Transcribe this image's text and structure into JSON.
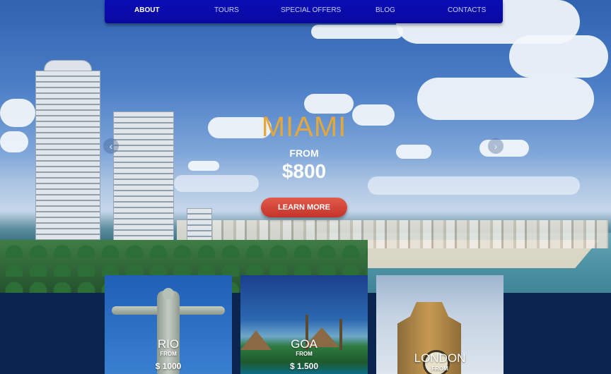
{
  "nav": {
    "items": [
      {
        "label": "ABOUT",
        "active": true
      },
      {
        "label": "TOURS",
        "active": false
      },
      {
        "label": "SPECIAL OFFERS",
        "active": false
      },
      {
        "label": "BLOG",
        "active": false
      },
      {
        "label": "CONTACTS",
        "active": false
      }
    ]
  },
  "hero": {
    "title": "MIAMI",
    "from_label": "FROM",
    "price": "$800",
    "cta_label": "LEARN MORE",
    "prev_arrow": "‹",
    "next_arrow": "›"
  },
  "cards": [
    {
      "city": "RIO",
      "from_label": "FROM",
      "price": "$ 1000"
    },
    {
      "city": "GOA",
      "from_label": "FROM",
      "price": "$ 1.500"
    },
    {
      "city": "LONDON",
      "from_label": "FROM",
      "price": ""
    }
  ],
  "colors": {
    "nav_bg": "#0b0db5",
    "hero_title": "#e2a83c",
    "cta_button": "#d6453a",
    "page_bg": "#0a2550"
  },
  "icons": {
    "prev": "chevron-left-icon",
    "next": "chevron-right-icon"
  }
}
